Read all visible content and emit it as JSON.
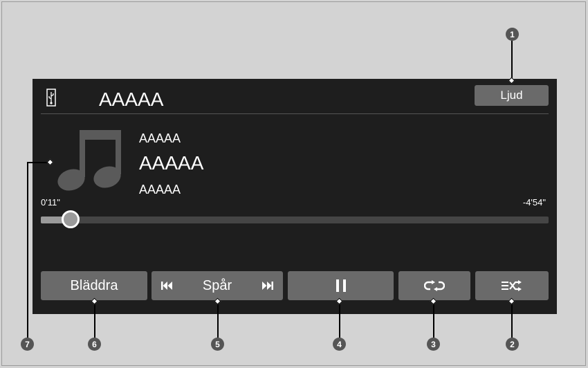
{
  "header": {
    "source_title": "AAAAA",
    "audio_button_label": "Ljud"
  },
  "now_playing": {
    "artist": "AAAAA",
    "track": "AAAAA",
    "album": "AAAAA",
    "elapsed": "0'11\"",
    "remaining": "-4'54\"",
    "progress_fraction": 0.058
  },
  "controls": {
    "browse_label": "Bläddra",
    "track_label": "Spår",
    "prev_icon": "skip-back-icon",
    "next_icon": "skip-forward-icon",
    "pause_icon": "pause-icon",
    "repeat_icon": "repeat-icon",
    "shuffle_icon": "shuffle-icon"
  },
  "callouts": [
    "1",
    "2",
    "3",
    "4",
    "5",
    "6",
    "7"
  ]
}
